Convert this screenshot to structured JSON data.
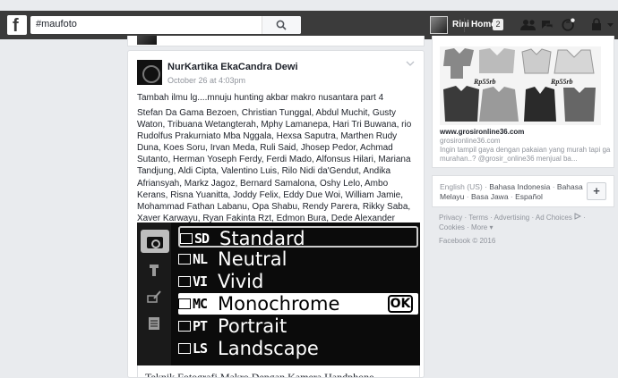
{
  "topbar": {
    "logo": "f",
    "search_value": "#maufoto",
    "search_icon": "search-icon",
    "profile_name": "Rini",
    "home_label": "Home",
    "home_badge": "2",
    "icons": [
      "friend-requests-icon",
      "messages-icon",
      "notifications-icon",
      "privacy-lock-icon",
      "chevron-down-icon"
    ]
  },
  "post": {
    "author": "NurKartika EkaCandra Dewi",
    "time": "October 26 at 4:03pm",
    "line1": "Tambah ilmu lg....mnuju hunting akbar makro nusantara part 4",
    "tags": "Stefan Da Gama Bezoen, Christian Tunggal, Abdul Muchit, Gusty Waton, Tribuana Wetangterah, Mphy Lamanepa, Hari Tri Buwana, rio Rudolfus Prakurniato Mba Nggala, Hexsa Saputra, Marthen Rudy Duna, Koes Soru, Irvan Meda, Ruli Said, Jhosep Pedor, Achmad Sutanto, Herman Yoseph Ferdy, Ferdi Mado, Alfonsus Hilari, Mariana Tandjung, Aldi Cipta, Valentino Luis, Rilo Nidi da'Gendut, Andika Afriansyah, Markz Jagoz, Bernard Samalona, Oshy Lelo, Ambo Kerans, Risna Yuanitta, Joddy Felix, Eddy Due Woi, William Jamie, Mohammad Fathan Labanu, Opa Shabu, Rendy Parera, Rikky Saba, Xaver Karwayu, Ryan Fakinta Rzt, Edmon Bura, Dede Alexander",
    "caption": "Teknik Fotografi Makro Dengan Kamera Handphone",
    "camera_menu": [
      {
        "code": "SD",
        "label": "Standard",
        "state": "outlined"
      },
      {
        "code": "NL",
        "label": "Neutral",
        "state": "normal"
      },
      {
        "code": "VI",
        "label": "Vivid",
        "state": "normal"
      },
      {
        "code": "MC",
        "label": "Monochrome",
        "state": "active"
      },
      {
        "code": "PT",
        "label": "Portrait",
        "state": "normal"
      },
      {
        "code": "LS",
        "label": "Landscape",
        "state": "normal"
      }
    ],
    "ok_label": "OK"
  },
  "ad": {
    "price1": "Rp55rb",
    "price2": "Rp55rb",
    "url": "www.grosironline36.com",
    "domain": "grosironline36.com",
    "text": "Ingin tampil gaya dengan pakaian yang murah tapi ga murahan..? @grosir_online36 menjual ba..."
  },
  "languages": {
    "current": "English (US)",
    "others": [
      "Bahasa Indonesia",
      "Bahasa Melayu",
      "Basa Jawa",
      "Español"
    ],
    "add_label": "+"
  },
  "footer": {
    "links": [
      "Privacy",
      "Terms",
      "Advertising",
      "Ad Choices",
      "Cookies",
      "More"
    ],
    "copyright": "Facebook © 2016"
  }
}
